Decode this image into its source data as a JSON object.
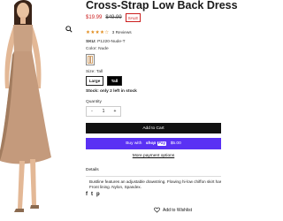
{
  "product": {
    "title": "Cross-Strap Low Back Dress",
    "price_sale": "$19.99",
    "price_original": "$49.99",
    "sale_badge": "SALE",
    "rating_stars": 4.5,
    "stars_glyphs": "★★★★☆",
    "reviews": "3 Reviews",
    "sku_label": "SKU:",
    "sku_value": "P1220-Nude-T",
    "color_label": "Color:",
    "color_value": "Nude",
    "size_label": "Size:",
    "size_value": "Tall",
    "sizes": [
      "Large",
      "Tall"
    ],
    "selected_size": "Tall",
    "stock": "Stock: only 2 left in stock",
    "quantity_label": "Quantity",
    "quantity": "1",
    "minus": "-",
    "plus": "+"
  },
  "actions": {
    "add_to_cart": "Add to Cart",
    "shop_pay_prefix": "Buy with",
    "shop_pay_brand": "shop",
    "shop_pay_suffix": "Pay",
    "shop_pay_installments": "$5.00",
    "more_payment": "More payment options",
    "wishlist": "Add to Wishlist"
  },
  "details": {
    "heading": "Details",
    "line1": "Bustline features an adjustable drawstring. Flowing hi-low chiffon skirt has",
    "line2": "Front lining. Nylon, Spandex."
  },
  "social": {
    "facebook": "f",
    "twitter": "t",
    "pinterest": "p"
  },
  "colors": {
    "sale_red": "#cc1f1f",
    "shop_pay_purple": "#5a31f4",
    "star_orange": "#e08a19"
  }
}
